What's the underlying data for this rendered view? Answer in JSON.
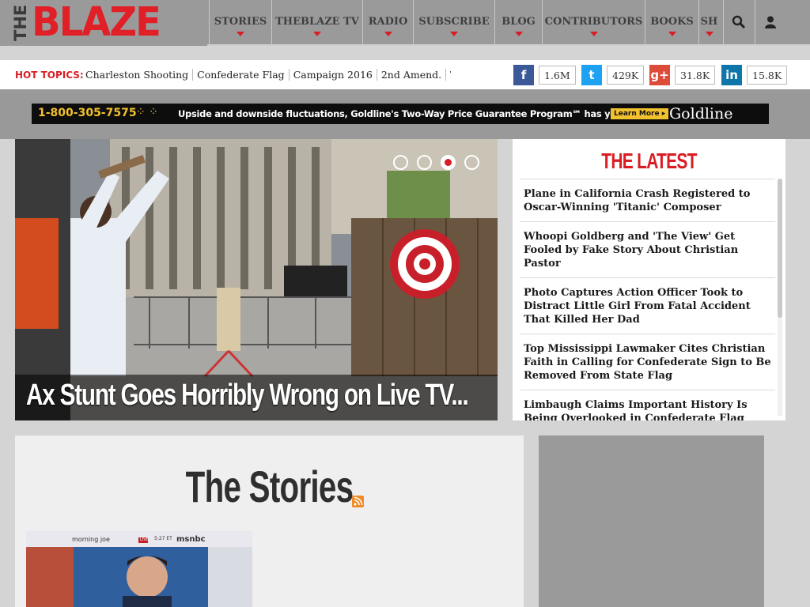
{
  "logo": {
    "prefix": "THE",
    "name": "BLAZE"
  },
  "nav": {
    "items": [
      "STORIES",
      "THEBLAZE TV",
      "RADIO",
      "SUBSCRIBE",
      "BLOG",
      "CONTRIBUTORS",
      "BOOKS",
      "SH"
    ],
    "search_icon": "search-icon",
    "account_icon": "user-icon"
  },
  "hot": {
    "label": "HOT TOPICS:",
    "topics": [
      "Charleston Shooting",
      "Confederate Flag",
      "Campaign 2016",
      "2nd Amend.",
      "TheBl"
    ]
  },
  "social": [
    {
      "network": "facebook",
      "glyph": "f",
      "count": "1.6M",
      "color": "#3b5998"
    },
    {
      "network": "twitter",
      "glyph": "t",
      "count": "429K",
      "color": "#1da1f2"
    },
    {
      "network": "google-plus",
      "glyph": "g+",
      "count": "31.8K",
      "color": "#dd4b39"
    },
    {
      "network": "linkedin",
      "glyph": "in",
      "count": "15.8K",
      "color": "#0e76a8"
    }
  ],
  "ad": {
    "phone": "1-800-305-7575",
    "message": "Upside and downside fluctuations, Goldline's Two-Way Price Guarantee Program℠ has you covered.",
    "cta": "Learn More",
    "brand": "Goldline"
  },
  "hero": {
    "title": "Ax Stunt Goes Horribly Wrong on Live TV...",
    "slide_count": 4,
    "active_slide": 3
  },
  "latest": {
    "title": "THE LATEST",
    "items": [
      "Plane in California Crash Registered to Oscar-Winning 'Titanic' Composer",
      "Whoopi Goldberg and 'The View' Get Fooled by Fake Story About Christian Pastor",
      "Photo Captures Action Officer Took to Distract Little Girl From Fatal Accident That Killed Her Dad",
      "Top Mississippi Lawmaker Cites Christian Faith in Calling for Confederate Sign to Be Removed From State Flag",
      "Limbaugh Claims Important History Is Being Overlooked in Confederate Flag Debate: 'Do People Care Anymore About"
    ]
  },
  "stories": {
    "title": "The Stories",
    "rss_icon": "rss-icon",
    "thumb_caption": "morning joe",
    "thumb_channel": "msnbc",
    "thumb_live": "LIVE",
    "thumb_time": "5:27 ET"
  }
}
